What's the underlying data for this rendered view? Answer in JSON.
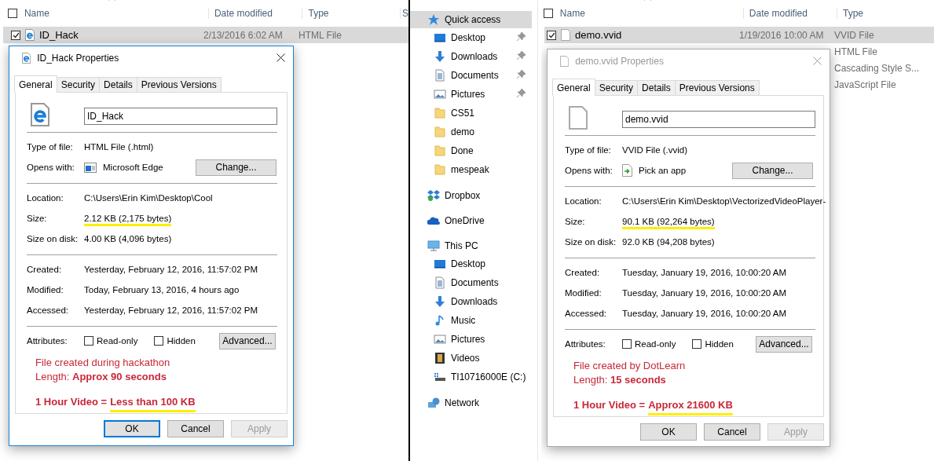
{
  "left_window": {
    "file_list": {
      "select_all": {
        "checked": false
      },
      "columns": [
        "Name",
        "Date modified",
        "Type",
        "S"
      ],
      "rows": [
        {
          "name": "ID_Hack",
          "date_modified": "2/13/2016 6:02 AM",
          "type": "HTML File",
          "kind": "browser",
          "selected": true,
          "checked": true
        }
      ]
    },
    "properties_dialog": {
      "active": true,
      "title": "ID_Hack Properties",
      "kind": "browser",
      "tabs": [
        {
          "label": "General",
          "selected": true
        },
        {
          "label": "Security",
          "selected": false
        },
        {
          "label": "Details",
          "selected": false
        },
        {
          "label": "Previous Versions",
          "selected": false
        }
      ],
      "file_name": "ID_Hack",
      "type_of_file": {
        "label": "Type of file:",
        "value": "HTML File (.html)"
      },
      "opens_with": {
        "label": "Opens with:",
        "app": "Microsoft Edge",
        "kind": "browser-app",
        "button": "Change..."
      },
      "location": {
        "label": "Location:",
        "value": "C:\\Users\\Erin Kim\\Desktop\\Cool"
      },
      "size": {
        "label": "Size:",
        "value": "2.12 KB (2,175 bytes)",
        "highlighted": true
      },
      "size_on_disk": {
        "label": "Size on disk:",
        "value": "4.00 KB (4,096 bytes)"
      },
      "created": {
        "label": "Created:",
        "value": "Yesterday, February 12, 2016, 11:57:02 PM"
      },
      "modified": {
        "label": "Modified:",
        "value": "Today, February 13, 2016, 4 hours ago"
      },
      "accessed": {
        "label": "Accessed:",
        "value": "Yesterday, February 12, 2016, 11:57:02 PM"
      },
      "attributes": {
        "label": "Attributes:",
        "checkboxes": [
          {
            "label": "Read-only",
            "checked": false
          },
          {
            "label": "Hidden",
            "checked": false
          }
        ],
        "button": "Advanced..."
      },
      "note": {
        "lines": [
          "File created during hackathon",
          "Length: **Approx 90 seconds**"
        ],
        "summary_label": "1 Hour Video =",
        "summary_value": "Less than 100  KB"
      },
      "buttons": [
        {
          "label": "OK",
          "kind": "default"
        },
        {
          "label": "Cancel",
          "kind": "normal"
        },
        {
          "label": "Apply",
          "kind": "disabled"
        }
      ]
    }
  },
  "navigation_pane": {
    "items": [
      {
        "label": "Quick access",
        "kind": "star",
        "selected": true,
        "children": [
          {
            "label": "Desktop",
            "kind": "desktop",
            "pinned": true,
            "selected": false
          },
          {
            "label": "Downloads",
            "kind": "download",
            "pinned": true,
            "selected": false
          },
          {
            "label": "Documents",
            "kind": "document",
            "pinned": true,
            "selected": false
          },
          {
            "label": "Pictures",
            "kind": "pictures",
            "pinned": true,
            "selected": false
          },
          {
            "label": "CS51",
            "kind": "folder",
            "pinned": false,
            "selected": false
          },
          {
            "label": "demo",
            "kind": "folder",
            "pinned": false,
            "selected": false
          },
          {
            "label": "Done",
            "kind": "folder",
            "pinned": false,
            "selected": false
          },
          {
            "label": "mespeak",
            "kind": "folder",
            "pinned": false,
            "selected": false
          }
        ]
      },
      {
        "label": "Dropbox",
        "kind": "dropbox",
        "selected": false
      },
      {
        "label": "OneDrive",
        "kind": "cloud",
        "selected": false
      },
      {
        "label": "This PC",
        "kind": "pc",
        "selected": false,
        "children": [
          {
            "label": "Desktop",
            "kind": "desktop",
            "pinned": false,
            "selected": false
          },
          {
            "label": "Documents",
            "kind": "document",
            "pinned": false,
            "selected": false
          },
          {
            "label": "Downloads",
            "kind": "download",
            "pinned": false,
            "selected": false
          },
          {
            "label": "Music",
            "kind": "music",
            "pinned": false,
            "selected": false
          },
          {
            "label": "Pictures",
            "kind": "pictures",
            "pinned": false,
            "selected": false
          },
          {
            "label": "Videos",
            "kind": "videos",
            "pinned": false,
            "selected": false
          },
          {
            "label": "TI10716000E (C:)",
            "kind": "drive",
            "pinned": false,
            "selected": false
          }
        ]
      },
      {
        "label": "Network",
        "kind": "network",
        "selected": false
      }
    ]
  },
  "right_window": {
    "file_list": {
      "select_all": {
        "checked": false
      },
      "columns": [
        "Name",
        "Date modified",
        "Type"
      ],
      "rows": [
        {
          "name": "demo.vvid",
          "date_modified": "1/19/2016 10:00 AM",
          "type": "VVID File",
          "kind": "blank",
          "selected": true,
          "checked": true
        },
        {
          "type": "HTML File",
          "selected": false
        },
        {
          "type": "Cascading Style S...",
          "selected": false
        },
        {
          "type": "JavaScript File",
          "selected": false
        }
      ]
    },
    "properties_dialog": {
      "active": false,
      "title": "demo.vvid Properties",
      "kind": "blank",
      "tabs": [
        {
          "label": "General",
          "selected": true
        },
        {
          "label": "Security",
          "selected": false
        },
        {
          "label": "Details",
          "selected": false
        },
        {
          "label": "Previous Versions",
          "selected": false
        }
      ],
      "file_name": "demo.vvid",
      "type_of_file": {
        "label": "Type of file:",
        "value": "VVID File (.vvid)"
      },
      "opens_with": {
        "label": "Opens with:",
        "app": "Pick an app",
        "kind": "pick-app",
        "button": "Change..."
      },
      "location": {
        "label": "Location:",
        "value": "C:\\Users\\Erin Kim\\Desktop\\VectorizedVideoPlayer-"
      },
      "size": {
        "label": "Size:",
        "value": "90.1 KB (92,264 bytes)",
        "highlighted": true
      },
      "size_on_disk": {
        "label": "Size on disk:",
        "value": "92.0 KB (94,208 bytes)"
      },
      "created": {
        "label": "Created:",
        "value": "Tuesday, January 19, 2016, 10:00:20 AM"
      },
      "modified": {
        "label": "Modified:",
        "value": "Tuesday, January 19, 2016, 10:00:20 AM"
      },
      "accessed": {
        "label": "Accessed:",
        "value": "Tuesday, January 19, 2016, 10:00:20 AM"
      },
      "attributes": {
        "label": "Attributes:",
        "checkboxes": [
          {
            "label": "Read-only",
            "checked": false
          },
          {
            "label": "Hidden",
            "checked": false
          }
        ],
        "button": "Advanced..."
      },
      "note": {
        "lines": [
          "File created by DotLearn",
          "Length: **15 seconds**"
        ],
        "summary_label": "1 Hour Video =",
        "summary_value": "Approx 21600 KB"
      },
      "buttons": [
        {
          "label": "OK",
          "kind": "normal"
        },
        {
          "label": "Cancel",
          "kind": "normal"
        },
        {
          "label": "Apply",
          "kind": "disabled"
        }
      ]
    }
  }
}
